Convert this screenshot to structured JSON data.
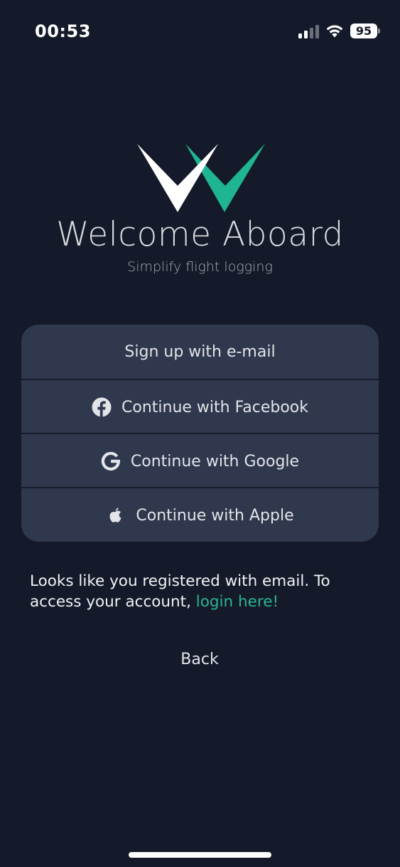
{
  "status_bar": {
    "time": "00:53",
    "battery": "95",
    "icons": [
      "signal-icon",
      "wifi-icon",
      "battery-icon"
    ]
  },
  "brand": {
    "logo_icon": "w-logo-icon",
    "title": "Welcome Aboard",
    "subtitle": "Simplify flight logging",
    "accent_color": "#1fb592"
  },
  "options": [
    {
      "label": "Sign up with e-mail",
      "icon": null
    },
    {
      "label": "Continue with Facebook",
      "icon": "facebook-icon"
    },
    {
      "label": "Continue with Google",
      "icon": "google-icon"
    },
    {
      "label": "Continue with Apple",
      "icon": "apple-icon"
    }
  ],
  "message": {
    "text": "Looks like you registered with email. To access your account, ",
    "link": "login here!"
  },
  "back_label": "Back",
  "colors": {
    "background": "#141a29",
    "card": "#2f384c",
    "link": "#2bb596"
  }
}
